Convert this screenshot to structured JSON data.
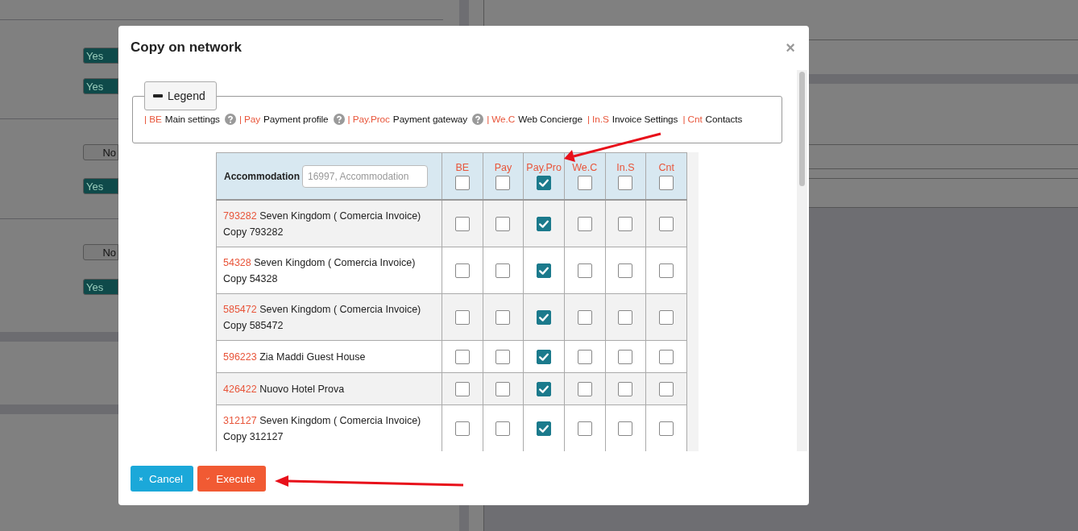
{
  "background": {
    "toggles": [
      {
        "label": "Yes",
        "on": true
      },
      {
        "label": "Yes",
        "on": true
      },
      {
        "label": "No",
        "on": false
      },
      {
        "label": "Yes",
        "on": true
      },
      {
        "label": "No",
        "on": false
      },
      {
        "label": "Yes",
        "on": true
      }
    ]
  },
  "modal": {
    "title": "Copy on network",
    "close_label": "×",
    "legend": {
      "toggle_label": "Legend",
      "items": [
        {
          "code": "| BE",
          "text": "Main settings",
          "help": false
        },
        {
          "code": "| Pay",
          "text": "Payment profile",
          "help": true
        },
        {
          "code": "| Pay.Proc",
          "text": "Payment gateway",
          "help": true
        },
        {
          "code": "| We.C",
          "text": "Web Concierge",
          "help": true
        },
        {
          "code": "| In.S",
          "text": "Invoice Settings",
          "help": false
        },
        {
          "code": "| Cnt",
          "text": "Contacts",
          "help": false
        }
      ]
    },
    "table": {
      "search_label": "Accommodation",
      "search_placeholder": "16997, Accommodation",
      "columns": [
        {
          "label": "BE",
          "checked": false
        },
        {
          "label": "Pay",
          "checked": false
        },
        {
          "label": "Pay.Pro",
          "checked": true
        },
        {
          "label": "We.C",
          "checked": false
        },
        {
          "label": "In.S",
          "checked": false
        },
        {
          "label": "Cnt",
          "checked": false
        }
      ],
      "rows": [
        {
          "id": "793282",
          "name": "Seven Kingdom ( Comercia Invoice) Copy 793282",
          "checks": [
            false,
            false,
            true,
            false,
            false,
            false
          ]
        },
        {
          "id": "54328",
          "name": "Seven Kingdom ( Comercia Invoice) Copy 54328",
          "checks": [
            false,
            false,
            true,
            false,
            false,
            false
          ]
        },
        {
          "id": "585472",
          "name": "Seven Kingdom ( Comercia Invoice) Copy 585472",
          "checks": [
            false,
            false,
            true,
            false,
            false,
            false
          ]
        },
        {
          "id": "596223",
          "name": "Zia Maddi Guest House",
          "checks": [
            false,
            false,
            true,
            false,
            false,
            false
          ]
        },
        {
          "id": "426422",
          "name": "Nuovo Hotel Prova",
          "checks": [
            false,
            false,
            true,
            false,
            false,
            false
          ]
        },
        {
          "id": "312127",
          "name": "Seven Kingdom ( Comercia Invoice) Copy 312127",
          "checks": [
            false,
            false,
            true,
            false,
            false,
            false
          ]
        }
      ]
    },
    "buttons": [
      {
        "label": "Cancel",
        "kind": "cancel"
      },
      {
        "label": "Execute",
        "kind": "execute"
      }
    ]
  }
}
